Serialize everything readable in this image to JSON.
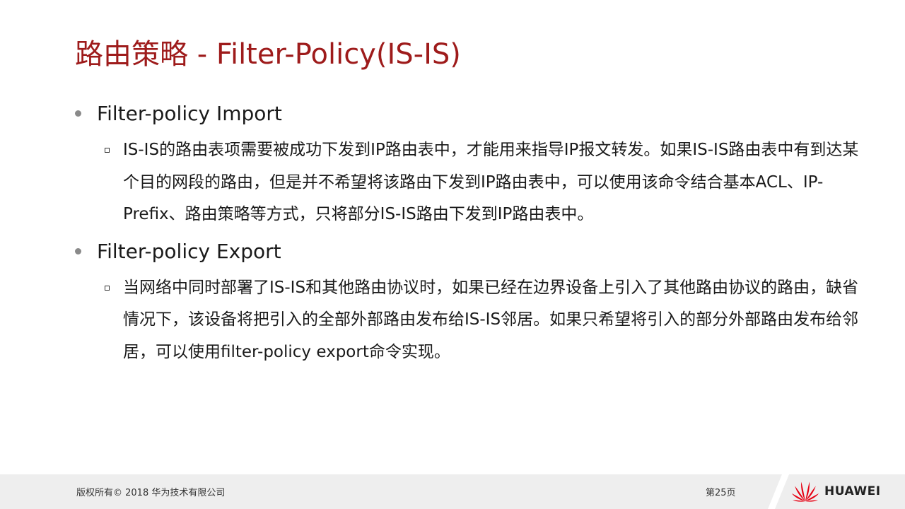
{
  "slide": {
    "title": "路由策略 - Filter-Policy(IS-IS)",
    "sections": [
      {
        "heading": "Filter-policy Import",
        "paragraph": "IS-IS的路由表项需要被成功下发到IP路由表中，才能用来指导IP报文转发。如果IS-IS路由表中有到达某个目的网段的路由，但是并不希望将该路由下发到IP路由表中，可以使用该命令结合基本ACL、IP-Prefix、路由策略等方式，只将部分IS-IS路由下发到IP路由表中。"
      },
      {
        "heading": "Filter-policy Export",
        "paragraph": "当网络中同时部署了IS-IS和其他路由协议时，如果已经在边界设备上引入了其他路由协议的路由，缺省情况下，该设备将把引入的全部外部路由发布给IS-IS邻居。如果只希望将引入的部分外部路由发布给邻居，可以使用filter-policy export命令实现。"
      }
    ]
  },
  "footer": {
    "copyright": "版权所有© 2018 华为技术有限公司",
    "page_number": "第25页",
    "brand": "HUAWEI"
  },
  "colors": {
    "title": "#9e1b1b",
    "footer_bg": "#eeeeee",
    "logo_red": "#e60012"
  },
  "icons": {
    "level1_bullet": "gray-dot-icon",
    "level2_bullet": "hollow-square-icon",
    "logo": "huawei-flower-logo-icon"
  }
}
